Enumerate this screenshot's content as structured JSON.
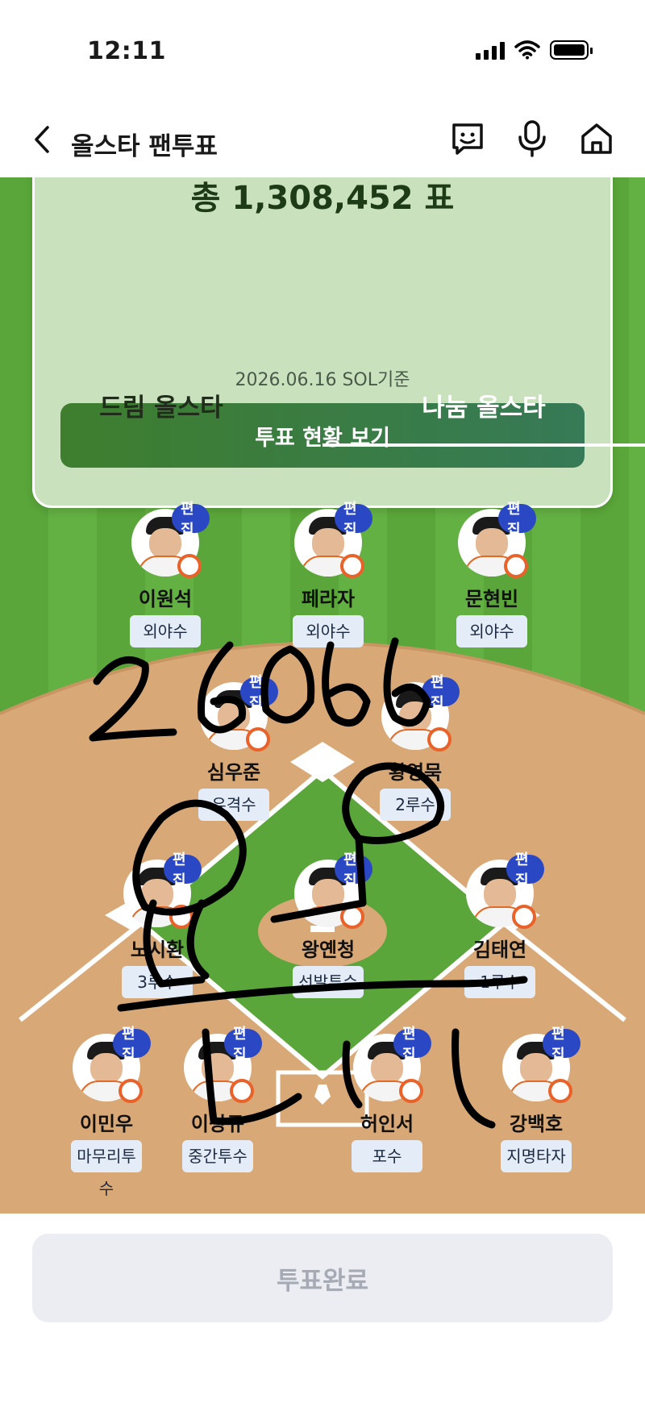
{
  "status_bar": {
    "time": "12:11"
  },
  "header": {
    "title": "올스타 팬투표"
  },
  "vote_card": {
    "count_text": "총 1,308,452 표",
    "date": "2026.06.16 SOL기준",
    "status_button": "투표 현황 보기"
  },
  "tabs": [
    {
      "label": "드림 올스타",
      "active": false
    },
    {
      "label": "나눔 올스타",
      "active": true
    }
  ],
  "edit_label": "편집",
  "players": [
    {
      "name": "이원석",
      "position": "외야수"
    },
    {
      "name": "페라자",
      "position": "외야수"
    },
    {
      "name": "문현빈",
      "position": "외야수"
    },
    {
      "name": "심우준",
      "position": "유격수"
    },
    {
      "name": "황영묵",
      "position": "2루수"
    },
    {
      "name": "노시환",
      "position": "3루수"
    },
    {
      "name": "왕옌청",
      "position": "선발투수"
    },
    {
      "name": "김태연",
      "position": "1루수"
    },
    {
      "name": "이민우",
      "position": "마무리투수"
    },
    {
      "name": "이상규",
      "position": "중간투수"
    },
    {
      "name": "허인서",
      "position": "포수"
    },
    {
      "name": "강백호",
      "position": "지명타자"
    }
  ],
  "vote_complete_button": "투표완료",
  "colors": {
    "field_green": "#5aa63a",
    "dirt": "#d9a877",
    "edit_badge": "#2a48c4",
    "status_button": "#3e7e2e"
  },
  "icons": [
    "back-chevron-icon",
    "chat-face-icon",
    "microphone-icon",
    "home-icon",
    "team-logo-icon"
  ]
}
